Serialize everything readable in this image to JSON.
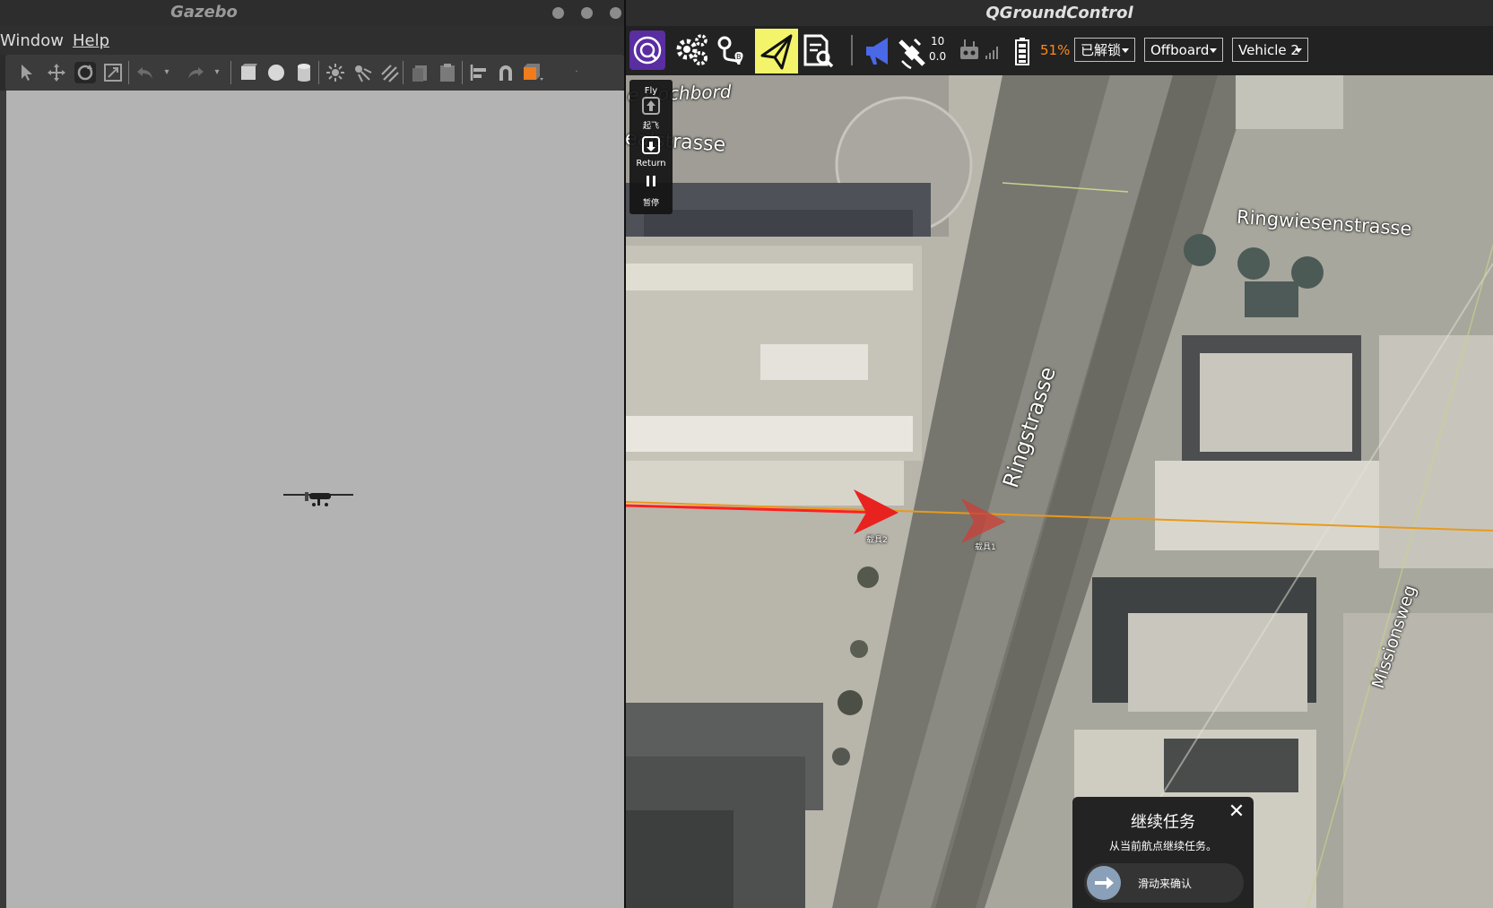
{
  "gazebo": {
    "title": "Gazebo",
    "menu": [
      "Window",
      "Help"
    ]
  },
  "qgc": {
    "title": "QGroundControl",
    "gps": {
      "satellites": "10",
      "hdop": "0.0"
    },
    "battery": "51%",
    "arm_status": "已解锁",
    "flight_mode": "Offboard",
    "vehicle": "Vehicle 2",
    "fly_panel": {
      "title": "Fly",
      "takeoff": "起飞",
      "return": "Return",
      "pause": "暂停"
    },
    "map": {
      "streets": [
        "Hochbord",
        "Stettbacherstrasse",
        "Ringwiesenstrasse",
        "Ringstrasse",
        "Missionsweg"
      ],
      "street_display": [
        "e Hochbord",
        "ealstrasse",
        "Ringwiesenstrasse",
        "Ringstrasse",
        "Missionsweg"
      ],
      "vehicle_labels": [
        "载具2",
        "载具1"
      ],
      "colors": {
        "path_red": "#ff1f1f",
        "path_orange": "#e89a1c",
        "vehicle_red": "#e8221f"
      }
    },
    "resume_dialog": {
      "title": "继续任务",
      "description": "从当前航点继续任务。",
      "slider_label": "滑动来确认"
    }
  }
}
